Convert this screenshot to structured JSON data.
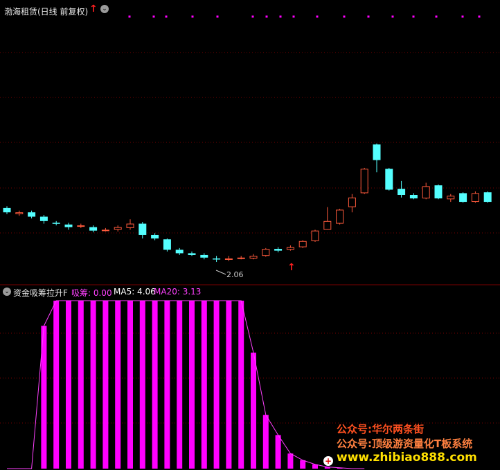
{
  "panel_main": {
    "title": "渤海租赁(日线 前复权)",
    "arrow_glyph": "↑",
    "menu_glyph": "⌄",
    "low_label": "2.06"
  },
  "panel_sub": {
    "title": "资金吸筹拉升F",
    "menu_glyph": "⌄",
    "xichou_label": "吸筹: 0.00",
    "ma5_label": "MA5: 4.06",
    "ma20_label": "MA20: 3.13"
  },
  "watermark": {
    "line1": "公众号:华尔两条街",
    "line2": "公众号:顶级游资量化T板系统",
    "line3": "www.zhibiao888.com"
  },
  "colors": {
    "background": "#000000",
    "up": "#ff5a3c",
    "down": "#54ffff",
    "magenta": "#ff00ff",
    "grid": "#7a0000",
    "arrow": "#ff2020"
  },
  "chart_data": [
    {
      "type": "candlestick",
      "title": "渤海租赁(日线 前复权)",
      "ylim": [
        1.8,
        4.8
      ],
      "annotations": [
        {
          "text": "2.06",
          "index": 17
        }
      ],
      "signals": [
        {
          "type": "up-arrow",
          "index": 23
        }
      ],
      "candles": [
        {
          "o": 2.65,
          "c": 2.6,
          "h": 2.67,
          "l": 2.58
        },
        {
          "o": 2.58,
          "c": 2.6,
          "h": 2.62,
          "l": 2.56
        },
        {
          "o": 2.6,
          "c": 2.55,
          "h": 2.62,
          "l": 2.53
        },
        {
          "o": 2.55,
          "c": 2.5,
          "h": 2.57,
          "l": 2.47
        },
        {
          "o": 2.48,
          "c": 2.47,
          "h": 2.5,
          "l": 2.45
        },
        {
          "o": 2.46,
          "c": 2.43,
          "h": 2.48,
          "l": 2.4
        },
        {
          "o": 2.44,
          "c": 2.45,
          "h": 2.47,
          "l": 2.42
        },
        {
          "o": 2.43,
          "c": 2.39,
          "h": 2.45,
          "l": 2.37
        },
        {
          "o": 2.39,
          "c": 2.4,
          "h": 2.42,
          "l": 2.38
        },
        {
          "o": 2.4,
          "c": 2.43,
          "h": 2.45,
          "l": 2.38
        },
        {
          "o": 2.42,
          "c": 2.47,
          "h": 2.52,
          "l": 2.4
        },
        {
          "o": 2.47,
          "c": 2.34,
          "h": 2.49,
          "l": 2.3
        },
        {
          "o": 2.34,
          "c": 2.3,
          "h": 2.36,
          "l": 2.28
        },
        {
          "o": 2.29,
          "c": 2.17,
          "h": 2.3,
          "l": 2.15
        },
        {
          "o": 2.17,
          "c": 2.13,
          "h": 2.19,
          "l": 2.11
        },
        {
          "o": 2.13,
          "c": 2.11,
          "h": 2.15,
          "l": 2.1
        },
        {
          "o": 2.11,
          "c": 2.08,
          "h": 2.13,
          "l": 2.06
        },
        {
          "o": 2.07,
          "c": 2.06,
          "h": 2.1,
          "l": 2.03
        },
        {
          "o": 2.06,
          "c": 2.07,
          "h": 2.1,
          "l": 2.04
        },
        {
          "o": 2.07,
          "c": 2.08,
          "h": 2.1,
          "l": 2.06
        },
        {
          "o": 2.07,
          "c": 2.1,
          "h": 2.12,
          "l": 2.06
        },
        {
          "o": 2.1,
          "c": 2.18,
          "h": 2.19,
          "l": 2.09
        },
        {
          "o": 2.18,
          "c": 2.16,
          "h": 2.2,
          "l": 2.14
        },
        {
          "o": 2.17,
          "c": 2.2,
          "h": 2.22,
          "l": 2.16
        },
        {
          "o": 2.2,
          "c": 2.27,
          "h": 2.28,
          "l": 2.19
        },
        {
          "o": 2.27,
          "c": 2.39,
          "h": 2.4,
          "l": 2.26
        },
        {
          "o": 2.4,
          "c": 2.5,
          "h": 2.66,
          "l": 2.4
        },
        {
          "o": 2.47,
          "c": 2.63,
          "h": 2.64,
          "l": 2.46
        },
        {
          "o": 2.66,
          "c": 2.77,
          "h": 2.81,
          "l": 2.6
        },
        {
          "o": 2.82,
          "c": 3.1,
          "h": 3.11,
          "l": 2.81
        },
        {
          "o": 3.38,
          "c": 3.2,
          "h": 3.39,
          "l": 3.06
        },
        {
          "o": 3.1,
          "c": 2.86,
          "h": 3.11,
          "l": 2.85
        },
        {
          "o": 2.87,
          "c": 2.8,
          "h": 2.96,
          "l": 2.77
        },
        {
          "o": 2.8,
          "c": 2.76,
          "h": 2.82,
          "l": 2.75
        },
        {
          "o": 2.76,
          "c": 2.9,
          "h": 2.94,
          "l": 2.75
        },
        {
          "o": 2.91,
          "c": 2.76,
          "h": 2.92,
          "l": 2.75
        },
        {
          "o": 2.75,
          "c": 2.79,
          "h": 2.81,
          "l": 2.72
        },
        {
          "o": 2.82,
          "c": 2.72,
          "h": 2.83,
          "l": 2.71
        },
        {
          "o": 2.72,
          "c": 2.82,
          "h": 2.84,
          "l": 2.71
        },
        {
          "o": 2.83,
          "c": 2.72,
          "h": 2.84,
          "l": 2.71
        }
      ]
    },
    {
      "type": "bar",
      "title": "资金吸筹拉升F",
      "series": [
        {
          "name": "吸筹",
          "color": "#ff00ff",
          "values": [
            0,
            0,
            0,
            85,
            100,
            100,
            100,
            100,
            100,
            100,
            100,
            100,
            100,
            100,
            100,
            100,
            100,
            100,
            100,
            100,
            69,
            32,
            20,
            9,
            5,
            2.5,
            1,
            0.5,
            0,
            0
          ]
        }
      ],
      "xichou": 0.0,
      "ma5": 4.06,
      "ma20": 3.13,
      "ylim": [
        0,
        100
      ]
    }
  ]
}
